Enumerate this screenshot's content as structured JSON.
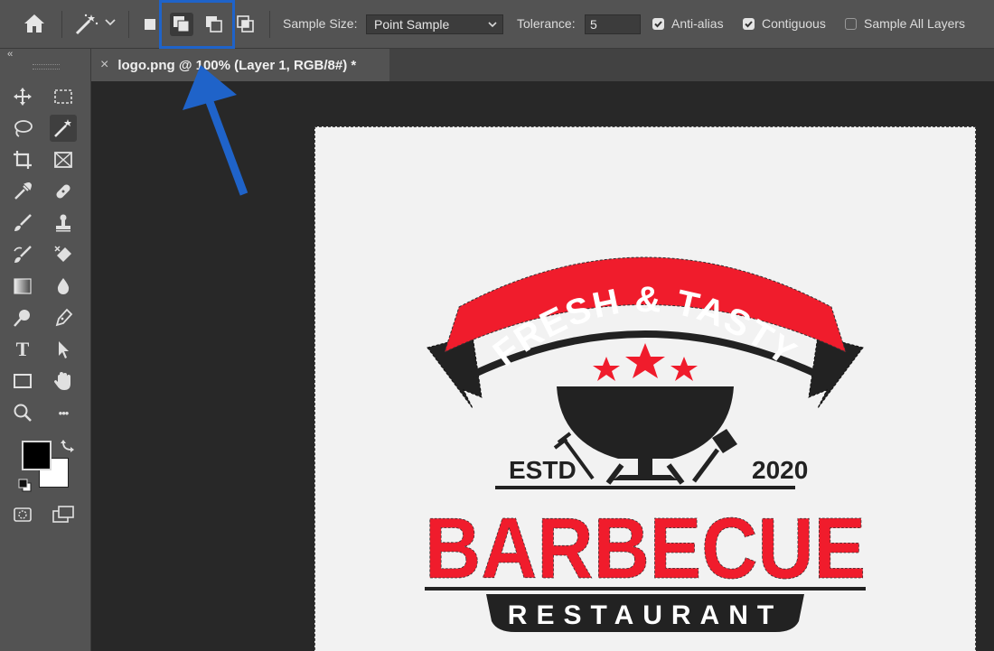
{
  "options_bar": {
    "sample_size_label": "Sample Size:",
    "sample_size_value": "Point Sample",
    "tolerance_label": "Tolerance:",
    "tolerance_value": "5",
    "anti_alias_label": "Anti-alias",
    "anti_alias_checked": true,
    "contiguous_label": "Contiguous",
    "contiguous_checked": true,
    "sample_all_layers_label": "Sample All Layers",
    "sample_all_layers_checked": false
  },
  "document": {
    "tab_title": "logo.png @ 100% (Layer 1, RGB/8#) *",
    "close_glyph": "×"
  },
  "logo": {
    "banner_text": "FRESH & TASTY",
    "estd_text": "ESTD",
    "year_text": "2020",
    "main_text": "BARBECUE",
    "sub_text": "RESTAURANT",
    "red": "#f01c2c",
    "dark": "#222222"
  },
  "toolbar": {
    "collapse_glyph": "‹‹",
    "type_tool_glyph": "T",
    "more_tools_glyph": "•••",
    "foreground_color": "#000000",
    "background_color": "#ffffff"
  },
  "annotation": {
    "highlight_color": "#1f63c9"
  }
}
